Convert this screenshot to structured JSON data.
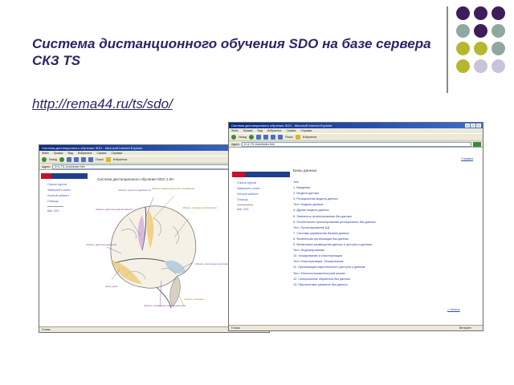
{
  "slide": {
    "title": "Система дистанционного обучения SDO на базе сервера СКЗ TS",
    "link": "http://rema44.ru/ts/sdo/"
  },
  "colors": {
    "title": "#2b2566",
    "dot_purple": "#3e1d5c",
    "dot_teal": "#8fa8a0",
    "dot_olive": "#b5b82e",
    "dot_lilac": "#c9c2d8"
  },
  "windows": [
    {
      "window_title": "Система дистанционного обучения SDO - Microsoft Internet Explorer",
      "menu": [
        "Файл",
        "Правка",
        "Вид",
        "Избранное",
        "Сервис",
        "Справка"
      ],
      "toolbar": [
        "Назад",
        "Поиск",
        "Избранное"
      ],
      "address_label": "Адрес:",
      "address": "D:\\1-TS-1\\sdo\\index.htm",
      "status_left": "Готово",
      "status_zone": "Интернет",
      "nav": [
        "Список курсов",
        "Завершить сеанс",
        "Личный кабинет",
        "Помощь",
        "Шаг СКЗ"
      ],
      "page_title": "Система дистанционного обучения SDO 1.0Н",
      "brain_labels": [
        "область двигательной активности",
        "область центра подвижности",
        "область кожно-мышечного понимания",
        "область слухового восприятия",
        "область двигательной речи",
        "центр речи",
        "область зрительного восприятия",
        "область понимания письменной речи",
        "область осязания"
      ]
    },
    {
      "window_title": "Система дистанционного обучения SDO - Microsoft Internet Explorer",
      "menu": [
        "Файл",
        "Правка",
        "Вид",
        "Избранное",
        "Сервис",
        "Справка"
      ],
      "toolbar": [
        "Назад",
        "Поиск",
        "Избранное"
      ],
      "address_label": "Адрес:",
      "address": "D:\\1-TS-1\\sdo\\index.htm",
      "status_left": "Готово",
      "status_zone": "Интернет",
      "nav": [
        "Список курсов",
        "Завершить сеанс",
        "Личный кабинет",
        "Помощь",
        "Шаг СКЗ"
      ],
      "help_link": "Справка",
      "course_heading": "Базы данных",
      "lessons": [
        "Уже",
        "1. Введение",
        "2. Модели данных",
        "3. Реляционная модель данных",
        "Тест. Модели данных",
        "4. Другие модели данных",
        "5. Элементы проектирования баз данных",
        "6. Особенности проектирования реляционных баз данных",
        "Тест. Проектирование БД",
        "7. Системы управления базами данных",
        "8. Физическая организация баз данных",
        "9. Механизмы размещения данных и доступа к данным",
        "Тест. Индексирование",
        "10. Хеширование и кластеризация",
        "Тест. Кластеризация. Хеширование",
        "11. Организация параллельного доступа к данным",
        "Тест. Многопользовательский режим",
        "12. Специальные обработки баз данных",
        "13. Перспективы развития баз данных"
      ],
      "next_link": "> Начало"
    }
  ]
}
